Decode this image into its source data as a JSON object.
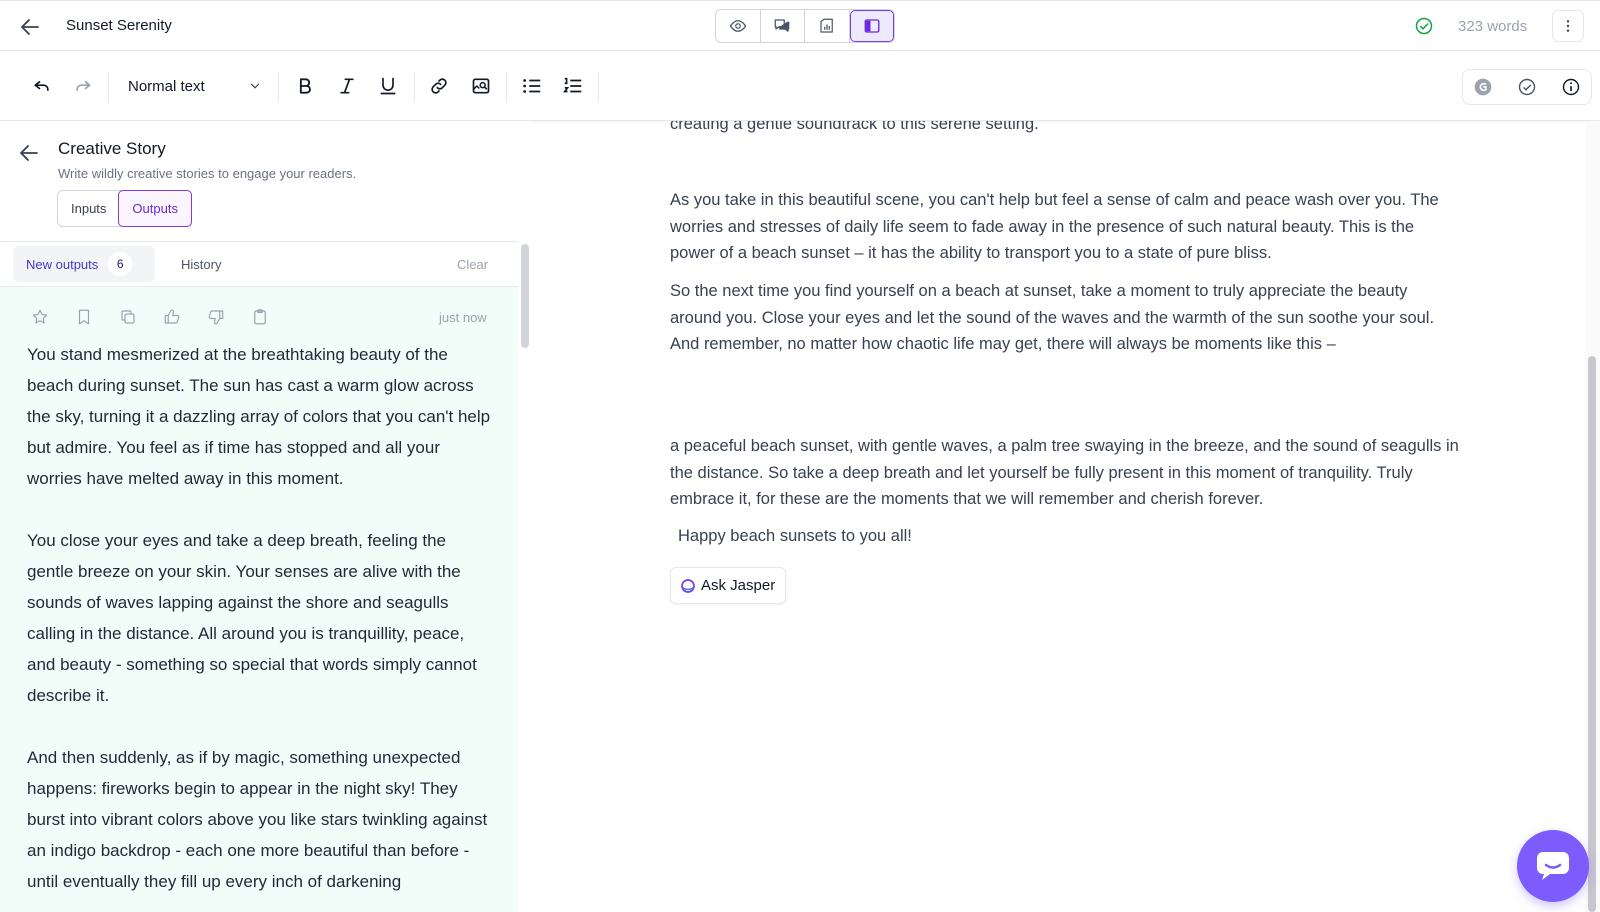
{
  "header": {
    "title": "Sunset Serenity",
    "word_count": "323 words"
  },
  "toolbar": {
    "text_style": "Normal text"
  },
  "panel": {
    "title": "Creative Story",
    "subtitle": "Write wildly creative stories to engage your readers.",
    "segments": [
      "Inputs",
      "Outputs"
    ],
    "tabs": {
      "new_outputs": "New outputs",
      "new_count": "6",
      "history": "History",
      "clear": "Clear"
    },
    "output": {
      "time": "just now",
      "paragraphs": [
        "You stand mesmerized at the breathtaking beauty of the beach during sunset. The sun has cast a warm glow across the sky, turning it a dazzling array of colors that you can't help but admire. You feel as if time has stopped and all your worries have melted away in this moment.",
        "You close your eyes and take a deep breath, feeling the gentle breeze on your skin. Your senses are alive with the sounds of waves lapping against the shore and seagulls calling in the distance. All around you is tranquillity, peace, and beauty - something so special that words simply cannot describe it.",
        "And then suddenly, as if by magic, something unexpected happens: fireworks begin to appear in the night sky! They burst into vibrant colors above you like stars twinkling against an indigo backdrop - each one more beautiful than before - until eventually they fill up every inch of darkening"
      ]
    }
  },
  "editor": {
    "lines": [
      "creating a gentle soundtrack to this serene setting.",
      "As you take in this beautiful scene, you can't help but feel a sense of calm and peace wash over you. The worries and stresses of daily life seem to fade away in the presence of such natural beauty. This is the power of a beach sunset – it has the ability to transport you to a state of pure bliss.",
      "So the next time you find yourself on a beach at sunset, take a moment to truly appreciate the beauty around you. Close your eyes and let the sound of the waves and the warmth of the sun soothe your soul. And remember, no matter how chaotic life may get, there will always be moments like this –",
      "a peaceful beach sunset, with gentle waves, a palm tree swaying in the breeze, and the sound of seagulls in the distance.  So take a deep breath and let yourself be fully present in this moment of tranquility.  Truly embrace it, for these are the moments that we will remember and cherish forever.",
      "Happy beach sunsets to you all!"
    ],
    "ask_button": "Ask Jasper"
  },
  "colors": {
    "accent": "#7c3aed",
    "output_bg": "#f0fdf9",
    "fab": "#7c5cfc",
    "status_ok": "#16a34a"
  }
}
